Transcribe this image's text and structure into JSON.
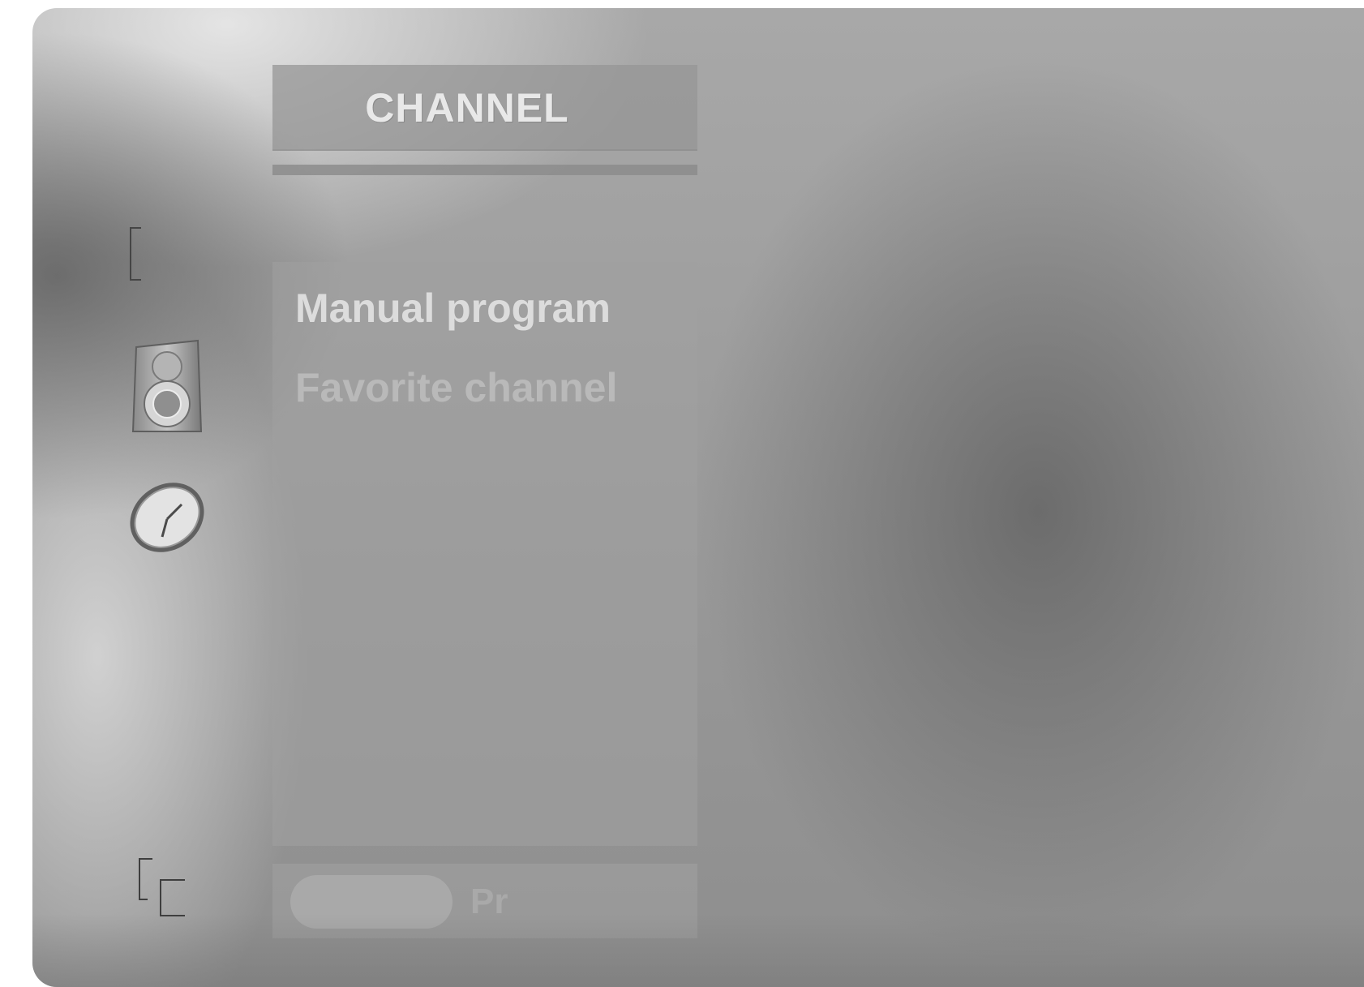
{
  "osd": {
    "title": "CHANNEL",
    "menu_items": [
      {
        "label": "Manual program"
      },
      {
        "label": "Favorite channel"
      }
    ],
    "footer": {
      "hint_text": "Pr"
    }
  },
  "side_icons": [
    {
      "name": "bracket-icon"
    },
    {
      "name": "speaker-icon"
    },
    {
      "name": "clock-icon"
    },
    {
      "name": "corner-bracket-icon"
    }
  ]
}
